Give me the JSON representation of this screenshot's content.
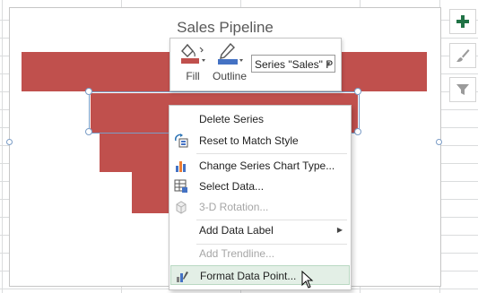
{
  "chart": {
    "title": "Sales Pipeline"
  },
  "mini_toolbar": {
    "fill_label": "Fill",
    "outline_label": "Outline",
    "series_select_value": "Series \"Sales\" P"
  },
  "side_buttons": {
    "add_element_icon": "plus-icon",
    "styles_icon": "brush-icon",
    "filter_icon": "filter-icon"
  },
  "context_menu": {
    "items": [
      {
        "label": "Delete Series",
        "enabled": true,
        "icon": "none"
      },
      {
        "label": "Reset to Match Style",
        "enabled": true,
        "icon": "reset-style-icon"
      },
      {
        "label": "Change Series Chart Type...",
        "enabled": true,
        "icon": "chart-type-icon"
      },
      {
        "label": "Select Data...",
        "enabled": true,
        "icon": "select-data-icon"
      },
      {
        "label": "3-D Rotation...",
        "enabled": false,
        "icon": "rotation-3d-icon"
      },
      {
        "label": "Add Data Label",
        "enabled": true,
        "icon": "none",
        "submenu": true
      },
      {
        "label": "Add Trendline...",
        "enabled": false,
        "icon": "none"
      },
      {
        "label": "Format Data Point...",
        "enabled": true,
        "icon": "format-data-point-icon",
        "highlighted": true
      }
    ]
  },
  "colors": {
    "bar": "#c0504d",
    "fill_swatch": "#c0504d",
    "outline_swatch": "#4472c4",
    "plus": "#217346",
    "hover": "#e3efe6"
  }
}
